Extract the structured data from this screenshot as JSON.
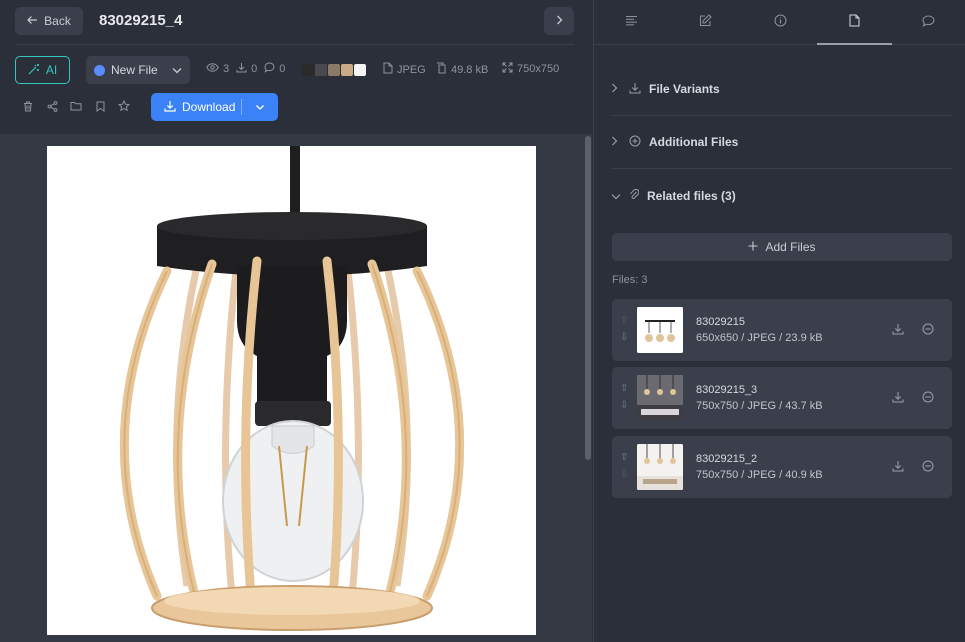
{
  "header": {
    "back_label": "Back",
    "title": "83029215_4"
  },
  "toolbar": {
    "ai_label": "AI",
    "status_label": "New File",
    "status_color": "#5b8cff",
    "views": "3",
    "downloads": "0",
    "comments": "0",
    "swatches": [
      "#2a2a2a",
      "#4a4a4e",
      "#8a7a66",
      "#c9ab85",
      "#f5f5f5"
    ],
    "format": "JPEG",
    "size": "49.8 kB",
    "dimensions": "750x750",
    "download_label": "Download",
    "accent": "#3b82f6"
  },
  "panel": {
    "tabs": [
      "description-icon",
      "edit-icon",
      "info-icon",
      "file-icon",
      "comment-icon"
    ],
    "active_tab": "file-icon",
    "sections": {
      "variants": "File Variants",
      "additional": "Additional Files",
      "related": "Related files (3)"
    },
    "add_files_label": "Add Files",
    "files_count": "Files: 3",
    "files": [
      {
        "name": "83029215",
        "info": "650x650 / JPEG / 23.9 kB"
      },
      {
        "name": "83029215_3",
        "info": "750x750 / JPEG / 43.7 kB"
      },
      {
        "name": "83029215_2",
        "info": "750x750 / JPEG / 40.9 kB"
      }
    ]
  }
}
